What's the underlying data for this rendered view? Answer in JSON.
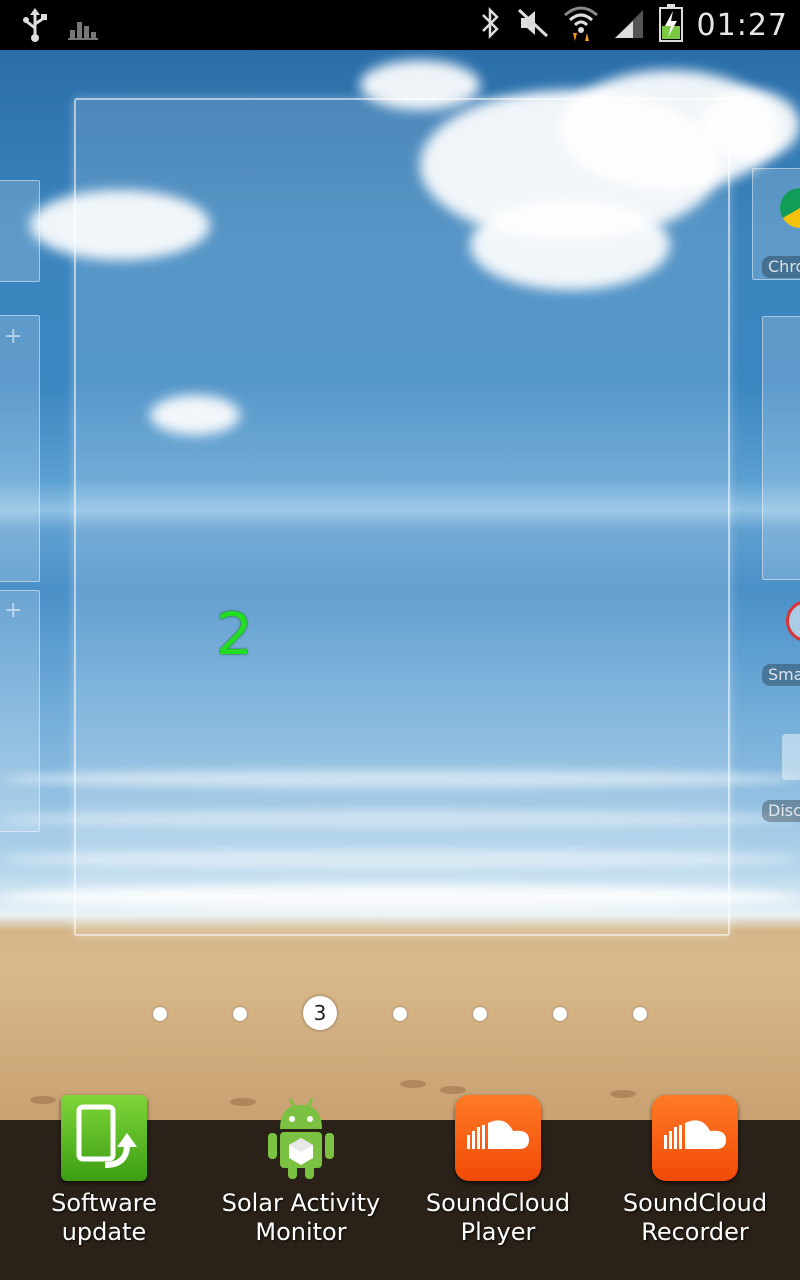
{
  "status_bar": {
    "time": "01:27",
    "left_icons": [
      "usb-icon",
      "signal-stats-icon"
    ],
    "right_icons": [
      "bluetooth-icon",
      "mute-icon",
      "wifi-icon",
      "cell-signal-icon",
      "battery-charging-icon"
    ]
  },
  "home": {
    "current_page_label": "2",
    "right_panel_labels": [
      "Chro",
      "Sma",
      "Disc"
    ]
  },
  "page_indicator": {
    "active_label": "3",
    "total_dots": 7,
    "active_index": 2
  },
  "dock": {
    "apps": [
      {
        "label": "Software update",
        "icon": "software-update-icon"
      },
      {
        "label": "Solar Activity\nMonitor",
        "icon": "android-icon"
      },
      {
        "label": "SoundCloud\nPlayer",
        "icon": "soundcloud-icon"
      },
      {
        "label": "SoundCloud\nRecorder",
        "icon": "soundcloud-icon"
      }
    ]
  },
  "colors": {
    "page_number": "#22dd22",
    "soundcloud_orange": "#f04a06",
    "software_update_green": "#3c9e12"
  }
}
